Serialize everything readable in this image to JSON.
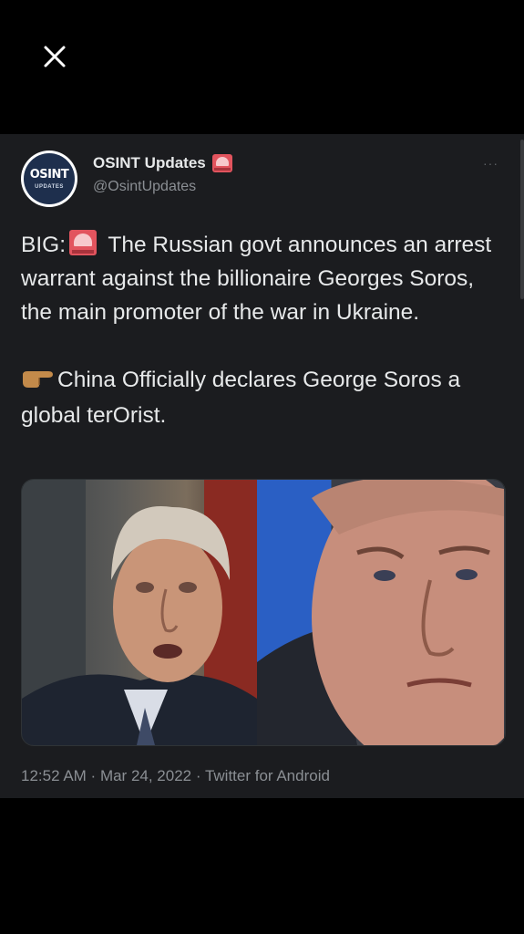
{
  "viewer": {
    "close_icon": "close-icon"
  },
  "tweet": {
    "author": {
      "display_name": "OSINT Updates",
      "handle": "@OsintUpdates",
      "avatar_text": "OSINT",
      "avatar_subtext": "UPDATES",
      "badge_icon": "police-siren-emoji"
    },
    "more_label": "···",
    "text": {
      "p1_prefix": "BIG:",
      "p1_rest": " The Russian govt announces an arrest warrant against the billionaire Georges Soros, the main promoter of the war in Ukraine.",
      "p2": "China Officially declares George Soros a global terOrist."
    },
    "media": {
      "left_image": "photo-george-soros",
      "right_image": "photo-vladimir-putin"
    },
    "time": "12:52 AM",
    "date": "Mar 24, 2022",
    "source": "Twitter for Android",
    "separator": " · "
  },
  "colors": {
    "background": "#000000",
    "card": "#1b1c1f",
    "text_primary": "#e7e9ea",
    "text_secondary": "#8b8f94",
    "siren_red": "#e2545e"
  }
}
